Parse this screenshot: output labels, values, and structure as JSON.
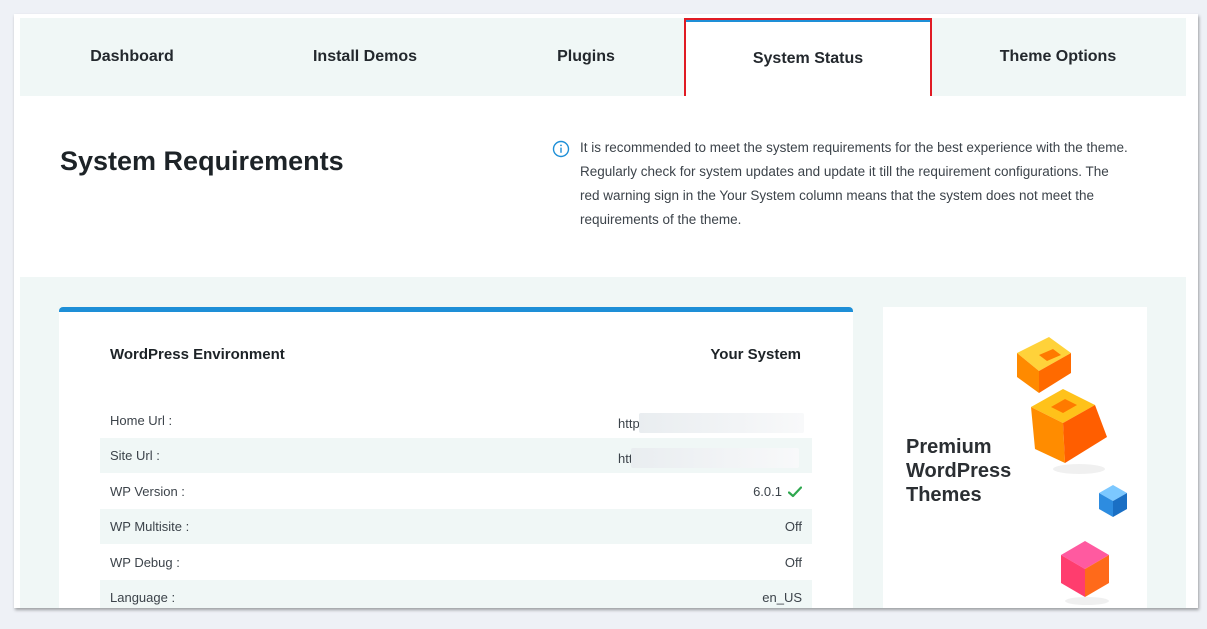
{
  "tabs": [
    {
      "label": "Dashboard"
    },
    {
      "label": "Install Demos"
    },
    {
      "label": "Plugins"
    },
    {
      "label": "System Status"
    },
    {
      "label": "Theme Options"
    }
  ],
  "active_tab": "System Status",
  "header": {
    "title": "System Requirements",
    "notice": "It is recommended to meet the system requirements for the best experience with the theme. Regularly check for system updates and update it till the requirement configurations. The red warning sign in the Your System column means that the system does not meet the requirements of the theme."
  },
  "table": {
    "col_left": "WordPress Environment",
    "col_right": "Your System",
    "rows": [
      {
        "label": "Home Url :",
        "value": "http"
      },
      {
        "label": "Site Url :",
        "value": "htt"
      },
      {
        "label": "WP Version :",
        "value": "6.0.1"
      },
      {
        "label": "WP Multisite :",
        "value": "Off"
      },
      {
        "label": "WP Debug :",
        "value": "Off"
      },
      {
        "label": "Language :",
        "value": "en_US"
      }
    ]
  },
  "promo": {
    "title": "Premium\nWordPress\nThemes"
  },
  "colors": {
    "accent": "#1e8fd7",
    "highlight": "#e01b24",
    "check": "#2fa84f",
    "panel_bg": "#f0f7f6"
  },
  "icons": {
    "info": "info-circle-icon",
    "check": "check-icon"
  }
}
